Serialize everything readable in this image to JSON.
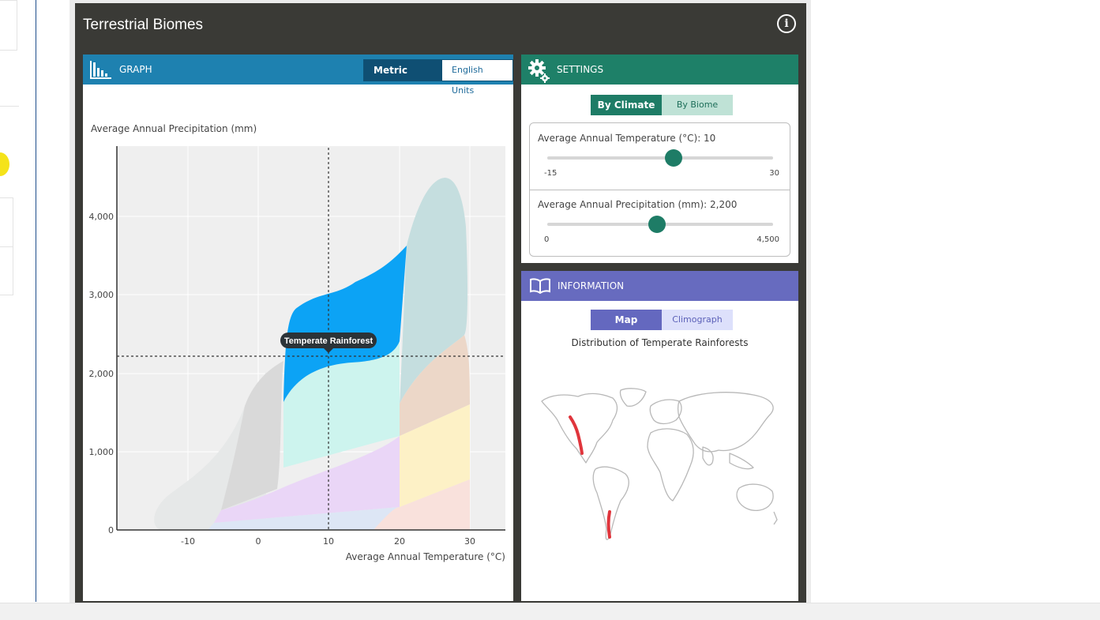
{
  "app": {
    "title": "Terrestrial Biomes"
  },
  "graph_panel": {
    "header": "GRAPH",
    "unit_toggle": {
      "active": "Metric Units",
      "inactive": "English Units"
    }
  },
  "settings_panel": {
    "header": "SETTINGS",
    "mode_toggle": {
      "active": "By Climate",
      "inactive": "By Biome"
    },
    "temperature": {
      "label": "Average Annual Temperature (°C): 10",
      "value": 10,
      "min_label": "-15",
      "max_label": "30",
      "min": -15,
      "max": 30
    },
    "precipitation": {
      "label": "Average Annual Precipitation (mm): 2,200",
      "value": 2200,
      "min_label": "0",
      "max_label": "4,500",
      "min": 0,
      "max": 4500
    }
  },
  "information_panel": {
    "header": "INFORMATION",
    "view_toggle": {
      "active": "Map",
      "inactive": "Climograph"
    },
    "distribution_title": "Distribution of Temperate Rainforests"
  },
  "chart_data": {
    "type": "area",
    "title": "",
    "xlabel": "Average Annual Temperature (°C)",
    "ylabel": "Average Annual Precipitation (mm)",
    "x_ticks": [
      "-10",
      "0",
      "10",
      "20",
      "30"
    ],
    "y_ticks": [
      "0",
      "1,000",
      "2,000",
      "3,000",
      "4,000"
    ],
    "xlim": [
      -20,
      35
    ],
    "ylim": [
      0,
      4900
    ],
    "grid": true,
    "crosshair": {
      "x": 10,
      "y": 2200
    },
    "selected_label": "Temperate Rainforest",
    "colors": {
      "tundra": "#e6e8e8",
      "boreal": "#d9d9d9",
      "temperate_forest": "#cdf4ee",
      "temperate_rainforest": "#0ca3f5",
      "grassland": "#ead6f7",
      "desert": "#dde6f5",
      "savanna": "#fdf1c6",
      "hot_desert": "#f9e1dc",
      "tropical_seasonal": "#ecd7c8",
      "tropical_rainforest": "#c5dedf"
    }
  }
}
